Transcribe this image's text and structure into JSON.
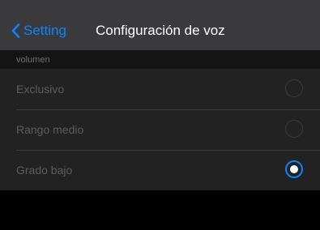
{
  "nav": {
    "back_label": "Setting",
    "title": "Configuración de voz"
  },
  "section": {
    "header": "volumen",
    "options": [
      {
        "label": "Exclusivo",
        "selected": false
      },
      {
        "label": "Rango medio",
        "selected": false
      },
      {
        "label": "Grado bajo",
        "selected": true
      }
    ]
  },
  "colors": {
    "accent": "#0a84ff",
    "nav_background": "#3a3a3c",
    "list_background": "#222222",
    "page_background": "#000000"
  }
}
